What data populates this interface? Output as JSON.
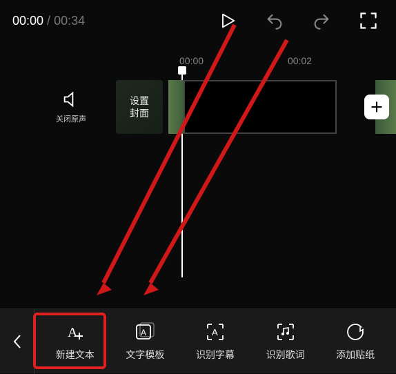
{
  "time": {
    "current": "00:00",
    "total": "00:34",
    "sep": " / "
  },
  "timeline": {
    "marks": [
      "00:00",
      "00:02"
    ]
  },
  "audio": {
    "label": "关闭原声"
  },
  "cover": {
    "line1": "设置",
    "line2": "封面"
  },
  "tools": {
    "new_text": "新建文本",
    "text_template": "文字模板",
    "recognize_subtitle": "识别字幕",
    "recognize_lyrics": "识别歌词",
    "add_sticker": "添加贴纸"
  },
  "colors": {
    "accent": "#e02020"
  }
}
